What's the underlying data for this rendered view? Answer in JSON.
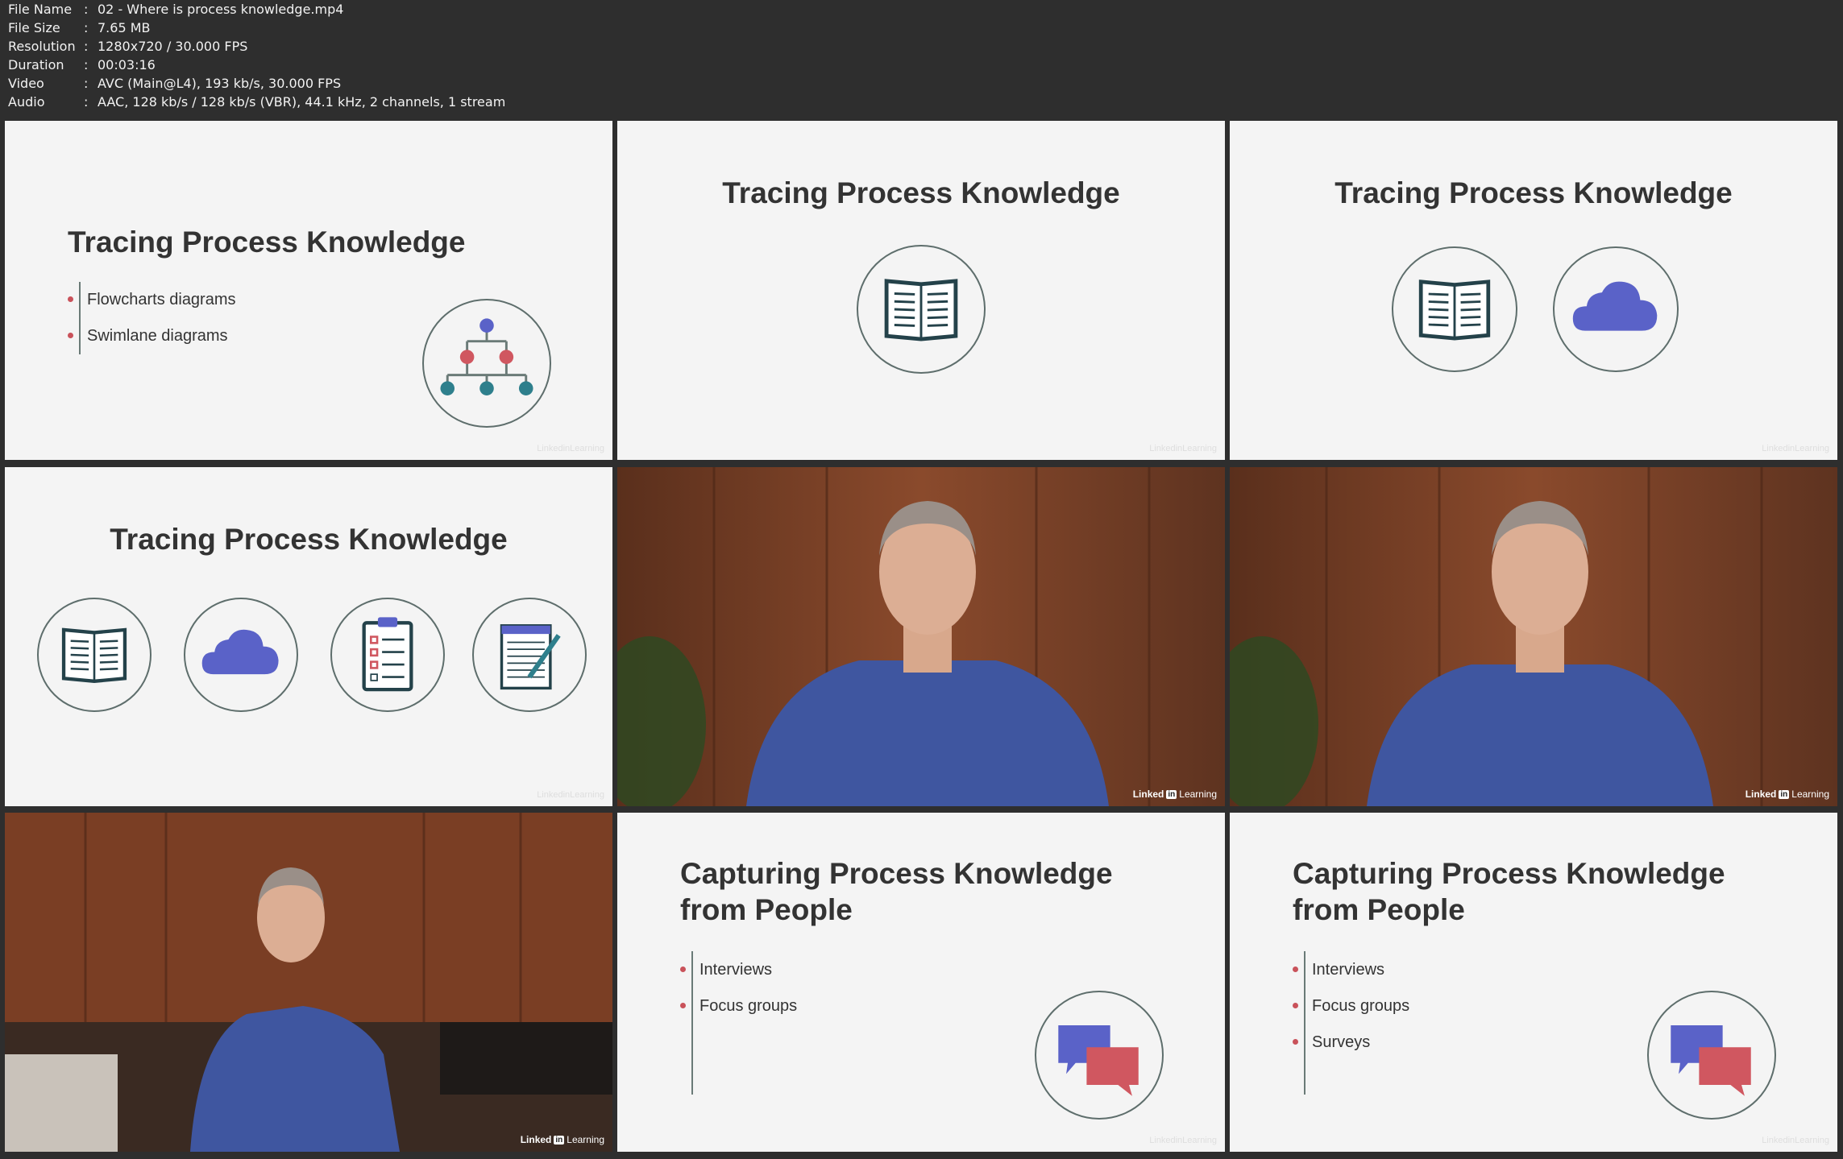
{
  "file_info": [
    {
      "key": "File Name",
      "value": "02 - Where is process knowledge.mp4"
    },
    {
      "key": "File Size",
      "value": "7.65 MB"
    },
    {
      "key": "Resolution",
      "value": "1280x720 / 30.000 FPS"
    },
    {
      "key": "Duration",
      "value": "00:03:16"
    },
    {
      "key": "Video",
      "value": "AVC (Main@L4), 193 kb/s, 30.000 FPS"
    },
    {
      "key": "Audio",
      "value": "AAC, 128 kb/s / 128 kb/s (VBR), 44.1 kHz, 2 channels, 1 stream"
    }
  ],
  "separator": ":",
  "tiles": {
    "t1": {
      "title": "Tracing Process Knowledge",
      "bullets": [
        "Flowcharts diagrams",
        "Swimlane diagrams"
      ],
      "icons": [
        "org-chart-icon"
      ]
    },
    "t2": {
      "title": "Tracing Process Knowledge",
      "icons": [
        "open-book-icon"
      ]
    },
    "t3": {
      "title": "Tracing Process Knowledge",
      "icons": [
        "open-book-icon",
        "cloud-icon"
      ]
    },
    "t4": {
      "title": "Tracing Process Knowledge",
      "icons": [
        "open-book-icon",
        "cloud-icon",
        "clipboard-checklist-icon",
        "notepad-pen-icon"
      ]
    },
    "t5": {
      "type": "presenter-video"
    },
    "t6": {
      "type": "presenter-video"
    },
    "t7": {
      "type": "presenter-video"
    },
    "t8": {
      "title_line1": "Capturing Process Knowledge",
      "title_line2": "from People",
      "bullets": [
        "Interviews",
        "Focus groups"
      ],
      "icons": [
        "chat-bubbles-icon"
      ]
    },
    "t9": {
      "title_line1": "Capturing Process Knowledge",
      "title_line2": "from People",
      "bullets": [
        "Interviews",
        "Focus groups",
        "Surveys"
      ],
      "icons": [
        "chat-bubbles-icon"
      ]
    }
  },
  "watermark": {
    "linked": "Linked",
    "in": "in",
    "learning": "Learning"
  },
  "colors": {
    "bullet": "#c9525a",
    "accent_blue": "#5a62c8",
    "accent_red": "#d05760",
    "accent_teal": "#2e7f8c",
    "frame": "#5e6e6c"
  }
}
